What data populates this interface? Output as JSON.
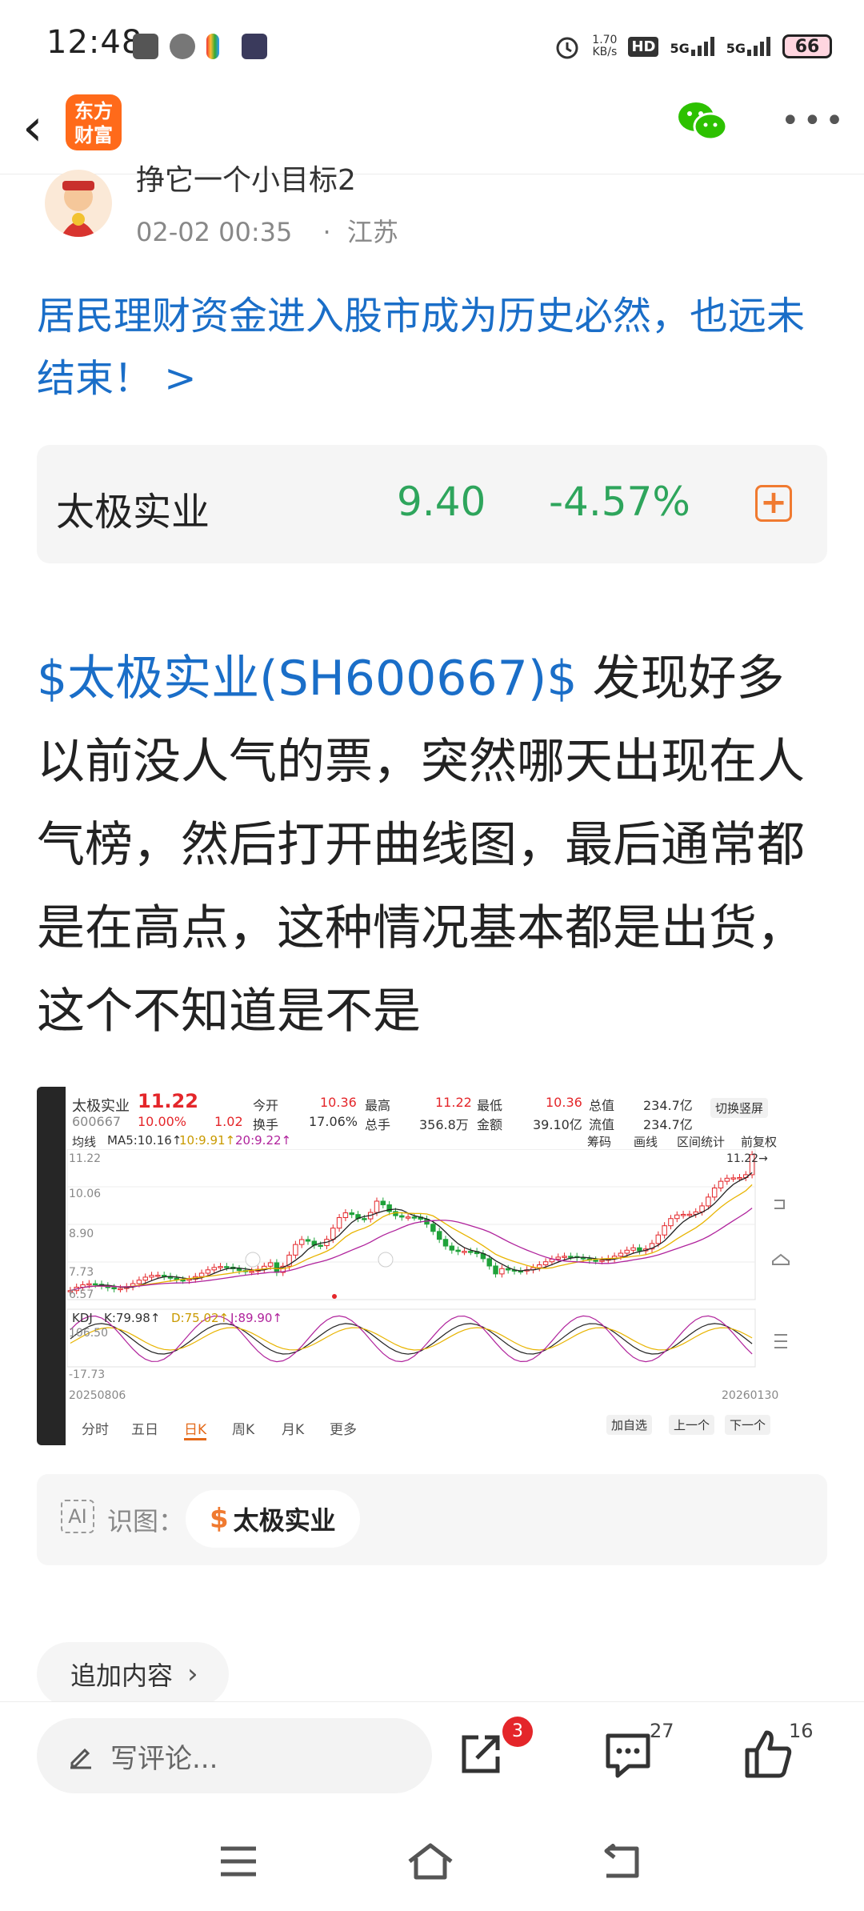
{
  "status_bar": {
    "time": "12:48",
    "net_speed": "1.70",
    "net_unit": "KB/s",
    "hd": "HD",
    "signal1": "5G",
    "signal2": "5G",
    "battery": "66"
  },
  "nav": {
    "logo_text": "东方财富",
    "back_icon": "chevron-left-icon",
    "share_icon": "wechat-icon",
    "more_icon": "more-horizontal-icon"
  },
  "author": {
    "name": "挣它一个小目标2",
    "time": "02-02 00:35",
    "separator": "·",
    "location": "江苏"
  },
  "headline": "居民理财资金进入股市成为历史必然，也远未结束！ >",
  "stock_card": {
    "name": "太极实业",
    "price": "9.40",
    "change": "-4.57%",
    "add_icon": "plus-square-icon",
    "color_down": "#2ea55c",
    "accent": "#f07a30"
  },
  "post": {
    "tag": "$太极实业(SH600667)$",
    "text": " 发现好多以前没人气的票，突然哪天出现在人气榜，然后打开曲线图，最后通常都是在高点，这种情况基本都是出货，这个不知道是不是"
  },
  "chart_image": {
    "name": "太极实业",
    "code": "600667",
    "price": "11.22",
    "pct": "10.00%",
    "chg": "1.02",
    "fields": {
      "open_label": "今开",
      "open": "10.36",
      "high_label": "最高",
      "high": "11.22",
      "low_label": "最低",
      "low": "10.36",
      "total_cap_label": "总值",
      "total_cap": "234.7亿",
      "turnover_label": "换手",
      "turnover": "17.06%",
      "vol_label": "总手",
      "vol": "356.8万",
      "amount_label": "金额",
      "amount": "39.10亿",
      "float_cap_label": "流值",
      "float_cap": "234.7亿"
    },
    "switch_label": "切换竖屏",
    "ma_label": "均线",
    "ma5": "MA5:10.16↑",
    "ma10": "10:9.91↑",
    "ma20": "20:9.22↑",
    "btn_chips": "筹码",
    "btn_draw": "画线",
    "btn_range": "区间统计",
    "btn_adjust": "前复权",
    "y_ticks": [
      "11.22",
      "10.06",
      "8.90",
      "7.73",
      "6.57"
    ],
    "last_label": "11.22→",
    "kdj_label": "KDJ",
    "kdj_k": "K:79.98↑",
    "kdj_d": "D:75.02↑",
    "kdj_j": "J:89.90↑",
    "kdj_ticks": [
      "106.50",
      "-17.73"
    ],
    "date_start": "20250806",
    "date_end": "20260130",
    "tabs": [
      "分时",
      "五日",
      "日K",
      "周K",
      "月K",
      "更多"
    ],
    "btn_add": "加自选",
    "btn_prev": "上一个",
    "btn_next": "下一个",
    "colors": {
      "ma5": "#222222",
      "ma10": "#e8b400",
      "ma20": "#b0239c",
      "up": "#e4262a",
      "down": "#1fa23a"
    }
  },
  "recognize": {
    "ai_icon": "ai-scan-icon",
    "label": "识图：",
    "stock": "太极实业"
  },
  "add_more": "追加内容",
  "actions": {
    "comment_placeholder": "写评论...",
    "share_badge": "3",
    "comments": "27",
    "likes": "16"
  }
}
